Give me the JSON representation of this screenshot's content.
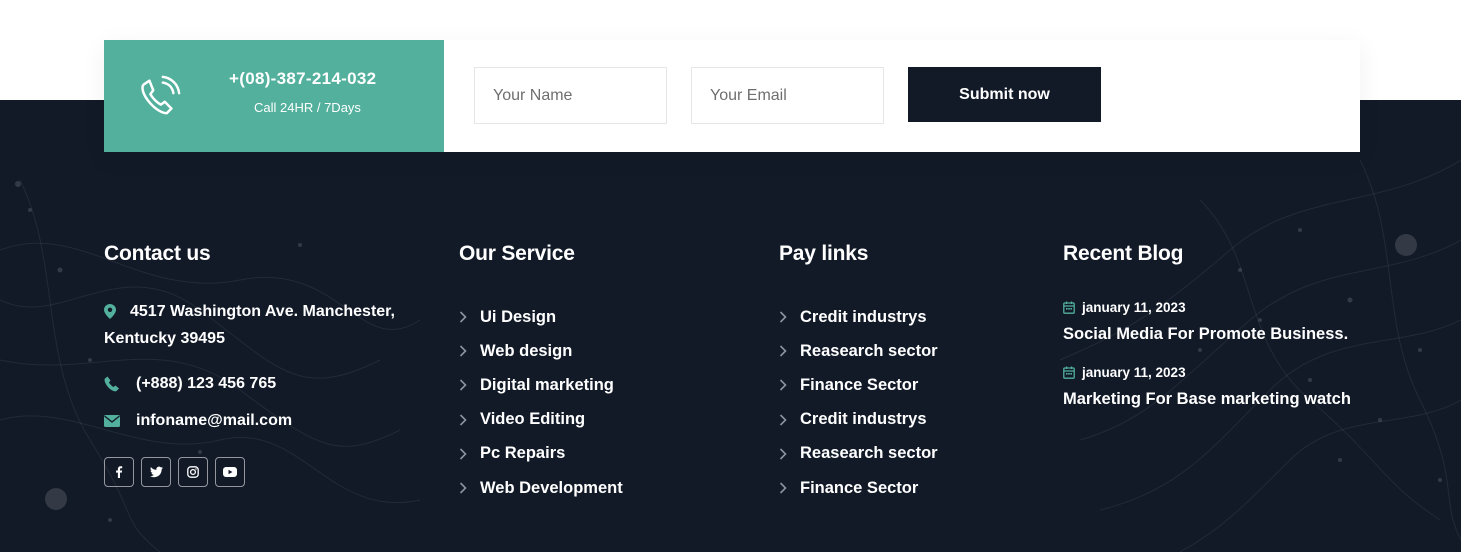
{
  "cta": {
    "phone_number": "+(08)-387-214-032",
    "phone_hours": "Call 24HR / 7Days",
    "name_placeholder": "Your Name",
    "email_placeholder": "Your Email",
    "submit_label": "Submit now"
  },
  "contact": {
    "heading": "Contact us",
    "address": "4517 Washington Ave. Manchester, Kentucky 39495",
    "phone": "(+888) 123 456 765",
    "email": "infoname@mail.com",
    "socials": [
      "facebook-icon",
      "twitter-icon",
      "instagram-icon",
      "youtube-icon"
    ]
  },
  "service": {
    "heading": "Our Service",
    "links": [
      "Ui Design",
      "Web design",
      "Digital marketing",
      "Video Editing",
      "Pc Repairs",
      "Web Development"
    ]
  },
  "pay": {
    "heading": "Pay links",
    "links": [
      "Credit industrys",
      "Reasearch sector",
      "Finance Sector",
      "Credit industrys",
      "Reasearch sector",
      "Finance Sector"
    ]
  },
  "blog": {
    "heading": "Recent Blog",
    "posts": [
      {
        "date": "january 11, 2023",
        "title": "Social Media For Promote Business."
      },
      {
        "date": "january 11, 2023",
        "title": "Marketing For Base marketing watch"
      }
    ]
  },
  "colors": {
    "accent": "#52b09d",
    "dark": "#121a28"
  }
}
